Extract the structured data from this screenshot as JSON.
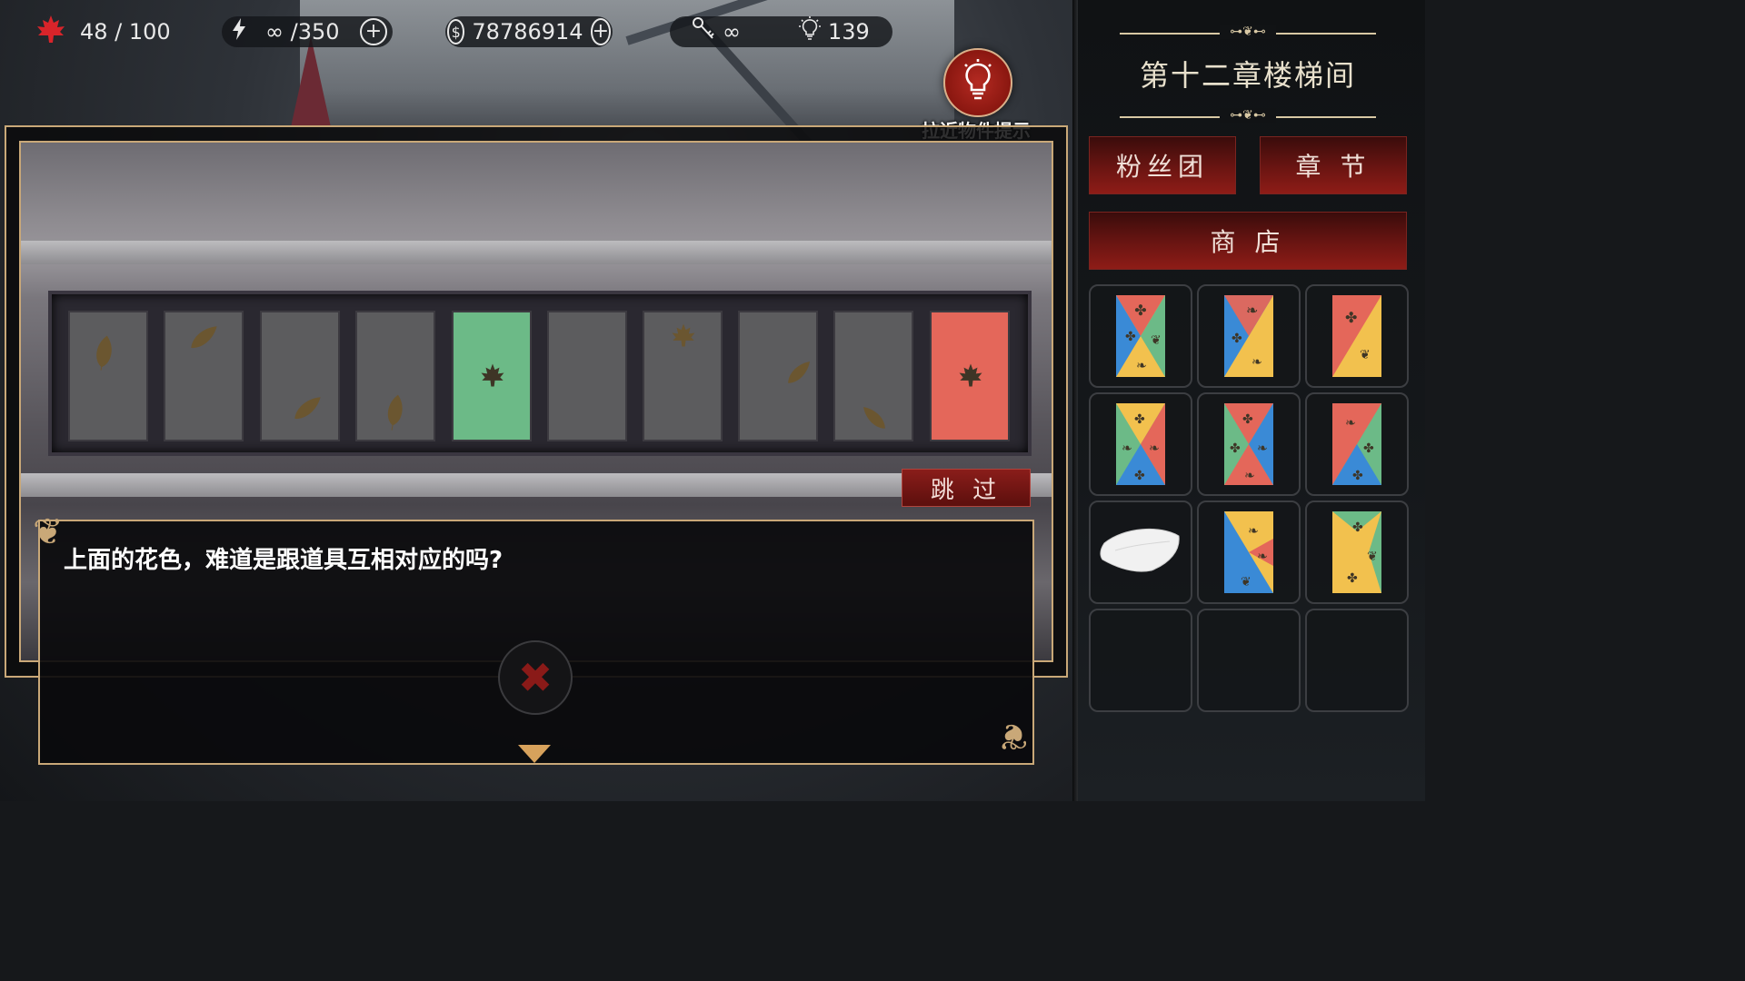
{
  "hud": {
    "leaf_icon": "maple-leaf-icon",
    "stamina": "48 / 100",
    "energy_icon": "lightning-icon",
    "energy": "∞ /350",
    "coin_icon": "dollar-coin-icon",
    "coins": "78786914",
    "key_icon": "key-icon",
    "keys": "∞",
    "hint_icon": "lightbulb-icon",
    "hints": "139",
    "plus": "+"
  },
  "hint_button": {
    "label": "拉近物件提示",
    "icon": "lightbulb-icon"
  },
  "puzzle": {
    "cards": [
      {
        "color": "gray",
        "mark": "leaf"
      },
      {
        "color": "gray",
        "mark": "leaf"
      },
      {
        "color": "gray",
        "mark": "leaf"
      },
      {
        "color": "gray",
        "mark": "leaf"
      },
      {
        "color": "green",
        "mark": "maple"
      },
      {
        "color": "gray",
        "mark": "none"
      },
      {
        "color": "gray",
        "mark": "maple"
      },
      {
        "color": "gray",
        "mark": "leaf"
      },
      {
        "color": "gray",
        "mark": "leaf"
      },
      {
        "color": "red",
        "mark": "maple"
      }
    ],
    "skip_label": "跳 过"
  },
  "dialog": {
    "text": "上面的花色，难道是跟道具互相对应的吗?",
    "close_icon": "close-x-icon",
    "next_icon": "down-arrow-icon"
  },
  "sidebar": {
    "chapter_title": "第十二章楼梯间",
    "fan_club": "粉丝团",
    "chapters": "章 节",
    "shop": "商 店",
    "inventory": [
      {
        "item": "colored-card-1"
      },
      {
        "item": "colored-card-2"
      },
      {
        "item": "colored-card-3"
      },
      {
        "item": "colored-card-4"
      },
      {
        "item": "colored-card-5"
      },
      {
        "item": "colored-card-6"
      },
      {
        "item": "white-pillow"
      },
      {
        "item": "colored-card-7"
      },
      {
        "item": "colored-card-8"
      },
      {
        "item": "empty"
      },
      {
        "item": "empty"
      },
      {
        "item": "empty"
      }
    ]
  },
  "colors": {
    "gold_border": "#c9a878",
    "card_green": "#6cba87",
    "card_red": "#e4675a",
    "card_gray": "#5c5c5e",
    "button_red": "#8e1c17",
    "yellow": "#f2c14e",
    "blue": "#3a8ad6"
  }
}
